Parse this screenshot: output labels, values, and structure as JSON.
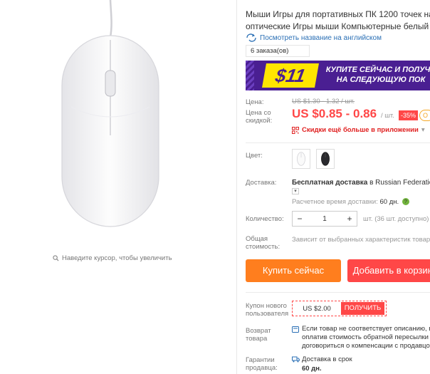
{
  "gallery": {
    "zoom_hint": "Наведите курсор, чтобы увеличить"
  },
  "product": {
    "title_line1": "Мыши Игры для портативных ПК 1200 точек на",
    "title_line2": "оптические Игры мыши Компьютерные белый 1",
    "translate_link": "Посмотреть название на английском",
    "orders": "6 заказа(ов)"
  },
  "promo": {
    "amount": "$11",
    "line1": "КУПИТЕ СЕЙЧАС И ПОЛУЧИ",
    "line2": "НА СЛЕДУЮЩУЮ ПОК"
  },
  "price": {
    "label": "Цена:",
    "old": "US $1.30 - 1.32 / шт.",
    "discount_label_line1": "Цена со",
    "discount_label_line2": "скидкой:",
    "new": "US $0.85 - 0.86",
    "unit": "/ шт.",
    "discount": "-35%",
    "extra_badge": "О",
    "app_discount": "Скидки ещё больше в приложении",
    "app_discount_caret": "▾"
  },
  "color": {
    "label": "Цвет:",
    "options": [
      "white",
      "black"
    ]
  },
  "shipping": {
    "label": "Доставка:",
    "text_bold": "Бесплатная доставка",
    "text_rest": " в Russian Federation",
    "dropdown_glyph": "▾",
    "eta_label": "Расчетное время доставки: ",
    "eta_value": "60 дн.",
    "help_glyph": "?"
  },
  "quantity": {
    "label": "Количество:",
    "minus": "−",
    "value": "1",
    "plus": "+",
    "note": "шт. (36 шт. доступно)"
  },
  "total": {
    "label_line1": "Общая",
    "label_line2": "стоимость:",
    "note": "Зависит от выбранных характеристик товара"
  },
  "actions": {
    "buy_now": "Купить сейчас",
    "add_to_cart": "Добавить в корзину"
  },
  "coupon": {
    "label_line1": "Купон нового",
    "label_line2": "пользователя",
    "value": "US $2.00",
    "get": "ПОЛУЧИТЬ"
  },
  "returns": {
    "label_line1": "Возврат",
    "label_line2": "товара",
    "line1": "Если товар не соответствует описанию, в",
    "line2": "оплатив стоимость обратной пересылки",
    "line3": "договориться о компенсации с продавцо"
  },
  "guarantee": {
    "label_line1": "Гарантии",
    "label_line2": "продавца:",
    "text": "Доставка в срок",
    "days": "60 дн."
  },
  "colors": {
    "price_red": "#ff4747",
    "buy_orange": "#ff7e1e",
    "promo_purple": "#4a1f92",
    "promo_yellow": "#ffe600",
    "link_blue": "#2a6fb5"
  }
}
